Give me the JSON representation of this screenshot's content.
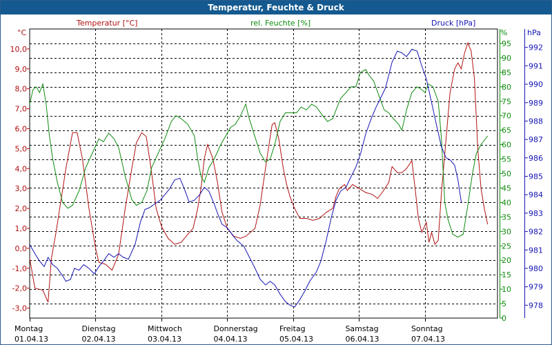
{
  "window": {
    "title": "Temperatur, Feuchte & Druck"
  },
  "chart_data": {
    "type": "line",
    "title": "Temperatur, Feuchte & Druck",
    "grid": true,
    "axes": {
      "temperature": {
        "label": "Temperatur [°C]",
        "unit": "°C",
        "range": [
          -3.5,
          11.0
        ],
        "ticks": [
          "10,0",
          "9,0",
          "8,0",
          "7,0",
          "6,0",
          "5,0",
          "4,0",
          "3,0",
          "2,0",
          "1,0",
          "0,0",
          "-1,0",
          "-2,0",
          "-3,0"
        ],
        "tick_values": [
          10,
          9,
          8,
          7,
          6,
          5,
          4,
          3,
          2,
          1,
          0,
          -1,
          -2,
          -3
        ],
        "color": "#b01010"
      },
      "humidity": {
        "label": "rel. Feuchte [%]",
        "unit": "%",
        "range": [
          0,
          100
        ],
        "ticks": [
          "95",
          "90",
          "85",
          "80",
          "75",
          "70",
          "65",
          "60",
          "55",
          "50",
          "45",
          "40",
          "35",
          "30",
          "25",
          "20",
          "15",
          "10",
          "5",
          "0"
        ],
        "tick_values": [
          95,
          90,
          85,
          80,
          75,
          70,
          65,
          60,
          55,
          50,
          45,
          40,
          35,
          30,
          25,
          20,
          15,
          10,
          5,
          0
        ],
        "color": "#0e8a0e"
      },
      "pressure": {
        "label": "Druck [hPa]",
        "unit": "hPa",
        "range": [
          977.3,
          993.0
        ],
        "ticks": [
          "992",
          "991",
          "990",
          "989",
          "988",
          "987",
          "986",
          "985",
          "984",
          "983",
          "982",
          "981",
          "980",
          "979",
          "978"
        ],
        "tick_values": [
          992,
          991,
          990,
          989,
          988,
          987,
          986,
          985,
          984,
          983,
          982,
          981,
          980,
          979,
          978
        ],
        "color": "#1414b4"
      }
    },
    "x_axis": {
      "range": [
        0,
        7.1
      ],
      "ticks": [
        {
          "day": "Montag",
          "date": "01.04.13"
        },
        {
          "day": "Dienstag",
          "date": "02.04.13"
        },
        {
          "day": "Mittwoch",
          "date": "03.04.13"
        },
        {
          "day": "Donnerstag",
          "date": "04.04.13"
        },
        {
          "day": "Freitag",
          "date": "05.04.13"
        },
        {
          "day": "Samstag",
          "date": "06.04.13"
        },
        {
          "day": "Sonntag",
          "date": "07.04.13"
        }
      ]
    },
    "series": [
      {
        "name": "Temperatur [°C]",
        "axis": "temperature",
        "color": "#b01010",
        "points": [
          [
            0.0,
            -0.5
          ],
          [
            0.08,
            -2.0
          ],
          [
            0.2,
            -2.1
          ],
          [
            0.28,
            -2.7
          ],
          [
            0.33,
            -0.5
          ],
          [
            0.4,
            0.8
          ],
          [
            0.55,
            4.0
          ],
          [
            0.65,
            5.8
          ],
          [
            0.72,
            5.8
          ],
          [
            0.8,
            4.5
          ],
          [
            0.9,
            2.0
          ],
          [
            1.0,
            0.0
          ],
          [
            1.05,
            -0.7
          ],
          [
            1.15,
            -0.8
          ],
          [
            1.25,
            -1.1
          ],
          [
            1.35,
            -0.3
          ],
          [
            1.45,
            2.0
          ],
          [
            1.55,
            4.0
          ],
          [
            1.62,
            5.3
          ],
          [
            1.7,
            5.8
          ],
          [
            1.77,
            5.6
          ],
          [
            1.85,
            3.8
          ],
          [
            1.92,
            2.0
          ],
          [
            2.0,
            1.1
          ],
          [
            2.1,
            0.5
          ],
          [
            2.2,
            0.2
          ],
          [
            2.3,
            0.3
          ],
          [
            2.4,
            0.7
          ],
          [
            2.48,
            1.0
          ],
          [
            2.55,
            2.0
          ],
          [
            2.6,
            3.0
          ],
          [
            2.65,
            4.5
          ],
          [
            2.7,
            5.2
          ],
          [
            2.78,
            4.5
          ],
          [
            2.85,
            3.3
          ],
          [
            2.92,
            1.8
          ],
          [
            3.0,
            1.0
          ],
          [
            3.1,
            0.6
          ],
          [
            3.2,
            0.5
          ],
          [
            3.28,
            0.6
          ],
          [
            3.35,
            0.8
          ],
          [
            3.42,
            1.0
          ],
          [
            3.5,
            2.2
          ],
          [
            3.6,
            4.5
          ],
          [
            3.68,
            6.2
          ],
          [
            3.72,
            6.3
          ],
          [
            3.78,
            5.5
          ],
          [
            3.85,
            4.0
          ],
          [
            3.9,
            3.2
          ],
          [
            3.95,
            2.6
          ],
          [
            4.02,
            2.0
          ],
          [
            4.1,
            1.5
          ],
          [
            4.2,
            1.5
          ],
          [
            4.3,
            1.4
          ],
          [
            4.4,
            1.5
          ],
          [
            4.5,
            1.8
          ],
          [
            4.6,
            2.0
          ],
          [
            4.65,
            2.6
          ],
          [
            4.7,
            3.0
          ],
          [
            4.78,
            3.2
          ],
          [
            4.82,
            2.9
          ],
          [
            4.9,
            3.2
          ],
          [
            5.0,
            3.0
          ],
          [
            5.1,
            2.8
          ],
          [
            5.2,
            2.7
          ],
          [
            5.28,
            2.5
          ],
          [
            5.35,
            2.8
          ],
          [
            5.45,
            3.3
          ],
          [
            5.5,
            4.1
          ],
          [
            5.58,
            3.8
          ],
          [
            5.65,
            3.8
          ],
          [
            5.72,
            4.0
          ],
          [
            5.8,
            4.4
          ],
          [
            5.85,
            3.0
          ],
          [
            5.9,
            1.5
          ],
          [
            5.95,
            0.8
          ],
          [
            6.02,
            1.3
          ],
          [
            6.06,
            0.3
          ],
          [
            6.1,
            0.8
          ],
          [
            6.15,
            0.2
          ],
          [
            6.2,
            0.4
          ],
          [
            6.25,
            2.8
          ],
          [
            6.32,
            5.5
          ],
          [
            6.38,
            7.8
          ],
          [
            6.45,
            9.0
          ],
          [
            6.5,
            9.3
          ],
          [
            6.55,
            9.0
          ],
          [
            6.6,
            9.8
          ],
          [
            6.65,
            10.3
          ],
          [
            6.7,
            9.9
          ],
          [
            6.75,
            8.5
          ],
          [
            6.8,
            5.0
          ],
          [
            6.85,
            3.0
          ],
          [
            6.9,
            2.0
          ],
          [
            6.95,
            1.2
          ]
        ]
      },
      {
        "name": "rel. Feuchte [%]",
        "axis": "humidity",
        "color": "#0e8a0e",
        "points": [
          [
            0.0,
            74
          ],
          [
            0.05,
            79
          ],
          [
            0.1,
            80
          ],
          [
            0.15,
            78
          ],
          [
            0.2,
            81
          ],
          [
            0.25,
            74
          ],
          [
            0.3,
            63
          ],
          [
            0.35,
            55
          ],
          [
            0.42,
            47
          ],
          [
            0.5,
            40
          ],
          [
            0.58,
            38
          ],
          [
            0.65,
            39
          ],
          [
            0.75,
            44
          ],
          [
            0.85,
            52
          ],
          [
            0.95,
            57
          ],
          [
            1.05,
            62
          ],
          [
            1.12,
            61
          ],
          [
            1.2,
            64
          ],
          [
            1.28,
            62
          ],
          [
            1.35,
            59
          ],
          [
            1.45,
            49
          ],
          [
            1.55,
            41
          ],
          [
            1.62,
            39
          ],
          [
            1.7,
            40
          ],
          [
            1.78,
            44
          ],
          [
            1.85,
            52
          ],
          [
            1.95,
            57
          ],
          [
            2.05,
            62
          ],
          [
            2.15,
            68
          ],
          [
            2.22,
            70
          ],
          [
            2.3,
            69
          ],
          [
            2.4,
            67
          ],
          [
            2.5,
            63
          ],
          [
            2.55,
            55
          ],
          [
            2.6,
            49
          ],
          [
            2.65,
            47
          ],
          [
            2.72,
            52
          ],
          [
            2.8,
            55
          ],
          [
            2.9,
            60
          ],
          [
            3.0,
            64
          ],
          [
            3.05,
            66
          ],
          [
            3.12,
            67
          ],
          [
            3.2,
            70
          ],
          [
            3.28,
            74
          ],
          [
            3.32,
            70
          ],
          [
            3.4,
            64
          ],
          [
            3.5,
            57
          ],
          [
            3.58,
            54
          ],
          [
            3.65,
            55
          ],
          [
            3.72,
            60
          ],
          [
            3.8,
            68
          ],
          [
            3.88,
            71
          ],
          [
            3.95,
            71
          ],
          [
            4.05,
            71
          ],
          [
            4.12,
            73
          ],
          [
            4.2,
            72
          ],
          [
            4.28,
            74
          ],
          [
            4.35,
            73
          ],
          [
            4.45,
            70
          ],
          [
            4.52,
            68
          ],
          [
            4.6,
            69
          ],
          [
            4.65,
            72
          ],
          [
            4.72,
            76
          ],
          [
            4.8,
            78
          ],
          [
            4.88,
            80
          ],
          [
            4.95,
            80
          ],
          [
            5.02,
            85
          ],
          [
            5.1,
            86
          ],
          [
            5.15,
            84
          ],
          [
            5.22,
            82
          ],
          [
            5.3,
            77
          ],
          [
            5.38,
            72
          ],
          [
            5.45,
            71
          ],
          [
            5.52,
            69
          ],
          [
            5.6,
            67
          ],
          [
            5.65,
            65
          ],
          [
            5.72,
            72
          ],
          [
            5.8,
            78
          ],
          [
            5.88,
            80
          ],
          [
            5.95,
            79
          ],
          [
            6.0,
            78
          ],
          [
            6.05,
            81
          ],
          [
            6.12,
            80
          ],
          [
            6.2,
            75
          ],
          [
            6.25,
            62
          ],
          [
            6.3,
            40
          ],
          [
            6.35,
            34
          ],
          [
            6.42,
            29
          ],
          [
            6.5,
            28
          ],
          [
            6.58,
            29
          ],
          [
            6.65,
            39
          ],
          [
            6.72,
            50
          ],
          [
            6.78,
            57
          ],
          [
            6.85,
            60
          ],
          [
            6.95,
            63
          ]
        ]
      },
      {
        "name": "Druck [hPa]",
        "axis": "pressure",
        "color": "#1414b4",
        "points": [
          [
            0.0,
            981.3
          ],
          [
            0.08,
            980.8
          ],
          [
            0.15,
            980.4
          ],
          [
            0.22,
            980.1
          ],
          [
            0.28,
            980.6
          ],
          [
            0.35,
            980.2
          ],
          [
            0.42,
            980.0
          ],
          [
            0.5,
            979.6
          ],
          [
            0.55,
            979.3
          ],
          [
            0.62,
            979.4
          ],
          [
            0.68,
            980.0
          ],
          [
            0.75,
            979.9
          ],
          [
            0.82,
            980.2
          ],
          [
            0.9,
            980.0
          ],
          [
            0.98,
            979.7
          ],
          [
            1.05,
            980.1
          ],
          [
            1.12,
            980.4
          ],
          [
            1.2,
            980.8
          ],
          [
            1.28,
            980.6
          ],
          [
            1.35,
            980.8
          ],
          [
            1.42,
            980.6
          ],
          [
            1.5,
            980.5
          ],
          [
            1.6,
            981.3
          ],
          [
            1.68,
            982.5
          ],
          [
            1.75,
            983.2
          ],
          [
            1.82,
            983.3
          ],
          [
            1.9,
            983.5
          ],
          [
            1.98,
            983.7
          ],
          [
            2.05,
            984.0
          ],
          [
            2.12,
            984.3
          ],
          [
            2.2,
            984.8
          ],
          [
            2.28,
            984.9
          ],
          [
            2.35,
            984.3
          ],
          [
            2.42,
            983.6
          ],
          [
            2.5,
            983.7
          ],
          [
            2.58,
            984.0
          ],
          [
            2.65,
            984.4
          ],
          [
            2.72,
            984.2
          ],
          [
            2.8,
            983.5
          ],
          [
            2.85,
            983.0
          ],
          [
            2.92,
            982.4
          ],
          [
            3.0,
            982.2
          ],
          [
            3.08,
            981.8
          ],
          [
            3.15,
            981.5
          ],
          [
            3.25,
            981.2
          ],
          [
            3.35,
            980.5
          ],
          [
            3.42,
            980.0
          ],
          [
            3.5,
            979.4
          ],
          [
            3.58,
            979.1
          ],
          [
            3.65,
            979.3
          ],
          [
            3.72,
            979.1
          ],
          [
            3.8,
            978.6
          ],
          [
            3.88,
            978.2
          ],
          [
            3.95,
            978.0
          ],
          [
            4.02,
            977.9
          ],
          [
            4.1,
            978.3
          ],
          [
            4.18,
            978.8
          ],
          [
            4.25,
            979.3
          ],
          [
            4.35,
            979.8
          ],
          [
            4.42,
            980.4
          ],
          [
            4.5,
            981.5
          ],
          [
            4.58,
            982.8
          ],
          [
            4.65,
            983.7
          ],
          [
            4.72,
            984.2
          ],
          [
            4.8,
            984.4
          ],
          [
            4.88,
            985.0
          ],
          [
            4.95,
            985.5
          ],
          [
            5.02,
            986.2
          ],
          [
            5.1,
            987.3
          ],
          [
            5.18,
            988.1
          ],
          [
            5.25,
            988.7
          ],
          [
            5.32,
            989.2
          ],
          [
            5.4,
            989.8
          ],
          [
            5.5,
            991.2
          ],
          [
            5.58,
            991.8
          ],
          [
            5.65,
            991.7
          ],
          [
            5.72,
            991.5
          ],
          [
            5.8,
            991.9
          ],
          [
            5.88,
            991.8
          ],
          [
            5.95,
            991.0
          ],
          [
            6.02,
            990.3
          ],
          [
            6.1,
            989.0
          ],
          [
            6.18,
            987.7
          ],
          [
            6.25,
            986.6
          ],
          [
            6.32,
            986.0
          ],
          [
            6.38,
            985.9
          ],
          [
            6.45,
            985.6
          ],
          [
            6.5,
            984.8
          ],
          [
            6.55,
            983.6
          ]
        ]
      }
    ]
  }
}
